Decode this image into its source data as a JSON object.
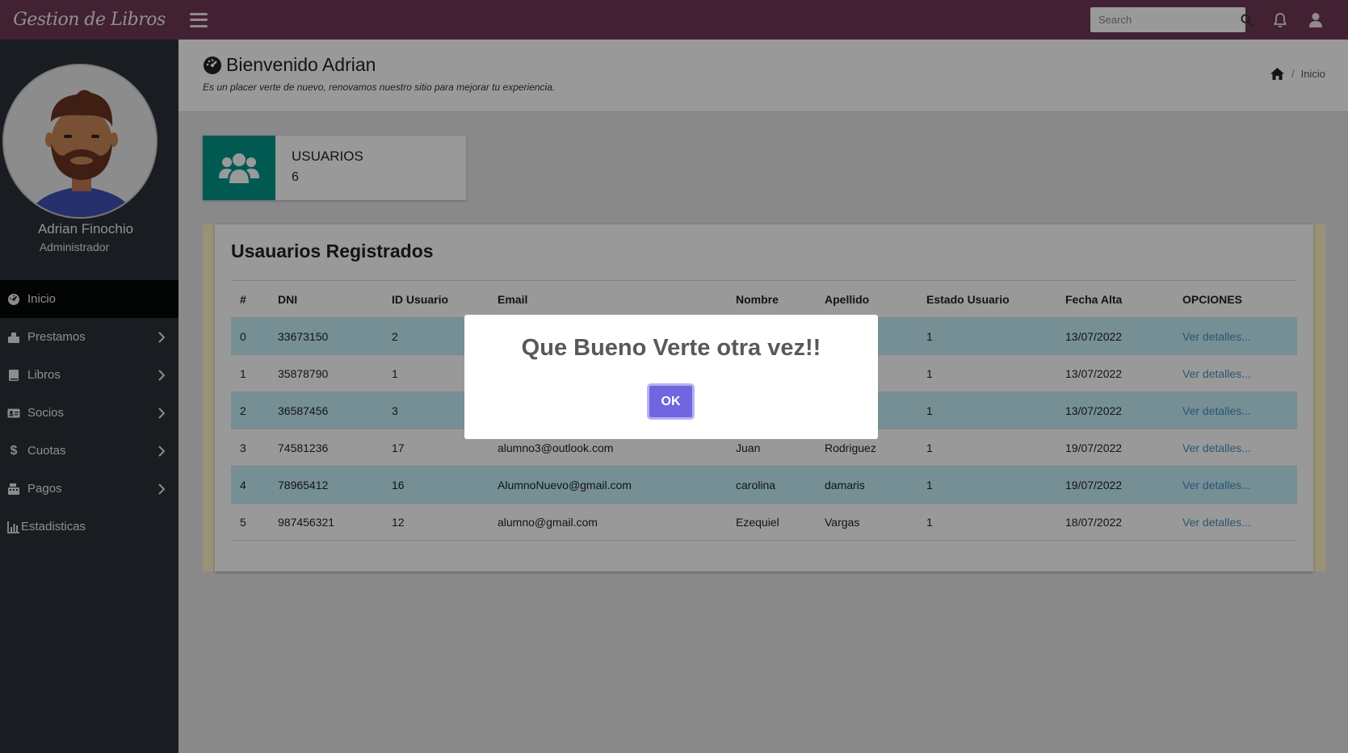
{
  "app": {
    "brand": "Gestion de Libros",
    "search_placeholder": "Search"
  },
  "sidebar": {
    "user_name": "Adrian Finochio",
    "user_role": "Administrador",
    "items": [
      {
        "label": "Inicio",
        "icon": "dashboard-icon",
        "active": true
      },
      {
        "label": "Prestamos",
        "icon": "handshake-icon",
        "has_submenu": true
      },
      {
        "label": "Libros",
        "icon": "book-icon",
        "has_submenu": true
      },
      {
        "label": "Socios",
        "icon": "id-card-icon",
        "has_submenu": true
      },
      {
        "label": "Cuotas",
        "icon": "dollar-icon",
        "has_submenu": true
      },
      {
        "label": "Pagos",
        "icon": "cash-register-icon",
        "has_submenu": true
      },
      {
        "label": "Estadisticas",
        "icon": "bar-chart-icon"
      }
    ]
  },
  "header": {
    "title": "Bienvenido Adrian",
    "subtitle": "Es un placer verte de nuevo, renovamos nuestro sitio para mejorar tu experiencia.",
    "breadcrumb": [
      "Inicio"
    ]
  },
  "stat": {
    "label": "USUARIOS",
    "value": "6",
    "color": "#009688"
  },
  "table": {
    "title": "Usauarios Registrados",
    "columns": [
      "#",
      "DNI",
      "ID Usuario",
      "Email",
      "Nombre",
      "Apellido",
      "Estado Usuario",
      "Fecha Alta",
      "OPCIONES"
    ],
    "rows": [
      [
        "0",
        "33673150",
        "2",
        "",
        "",
        "",
        "1",
        "13/07/2022",
        "Ver detalles..."
      ],
      [
        "1",
        "35878790",
        "1",
        "",
        "",
        "",
        "1",
        "13/07/2022",
        "Ver detalles..."
      ],
      [
        "2",
        "36587456",
        "3",
        "",
        "",
        "",
        "1",
        "13/07/2022",
        "Ver detalles..."
      ],
      [
        "3",
        "74581236",
        "17",
        "alumno3@outlook.com",
        "Juan",
        "Rodriguez",
        "1",
        "19/07/2022",
        "Ver detalles..."
      ],
      [
        "4",
        "78965412",
        "16",
        "AlumnoNuevo@gmail.com",
        "carolina",
        "damaris",
        "1",
        "19/07/2022",
        "Ver detalles..."
      ],
      [
        "5",
        "987456321",
        "12",
        "alumno@gmail.com",
        "Ezequiel",
        "Vargas",
        "1",
        "18/07/2022",
        "Ver detalles..."
      ]
    ]
  },
  "modal": {
    "title": "Que Bueno Verte otra vez!!",
    "ok_label": "OK",
    "button_color": "#7066e0"
  },
  "colors": {
    "topbar": "#6e3755",
    "sidebar": "#2a3138",
    "row_stripe": "#c3eef9",
    "link": "#4a8fbe"
  }
}
